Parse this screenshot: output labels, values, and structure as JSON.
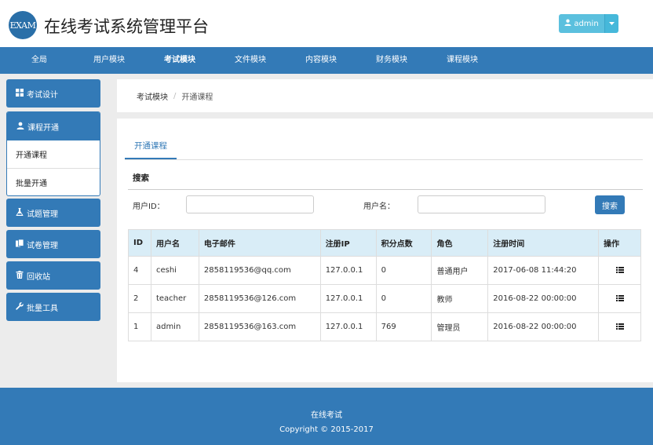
{
  "header": {
    "logo_text": "EXAM",
    "title": "在线考试系统管理平台",
    "user_name": "admin",
    "user_icon": "user-icon",
    "caret_icon": "caret-down-icon"
  },
  "nav": {
    "items": [
      {
        "label": "全局"
      },
      {
        "label": "用户模块"
      },
      {
        "label": "考试模块"
      },
      {
        "label": "文件模块"
      },
      {
        "label": "内容模块"
      },
      {
        "label": "财务模块"
      },
      {
        "label": "课程模块"
      }
    ],
    "active": "考试模块"
  },
  "sidebar": {
    "exam_design": {
      "label": "考试设计",
      "icon": "grid-icon"
    },
    "course_open": {
      "label": "课程开通",
      "icon": "user-icon",
      "subitems": [
        {
          "label": "开通课程"
        },
        {
          "label": "批量开通"
        }
      ]
    },
    "question_mgmt": {
      "label": "试题管理",
      "icon": "flask-icon"
    },
    "paper_mgmt": {
      "label": "试卷管理",
      "icon": "copy-icon"
    },
    "recycle": {
      "label": "回收站",
      "icon": "trash-icon"
    },
    "batch_tools": {
      "label": "批量工具",
      "icon": "wrench-icon"
    }
  },
  "breadcrumb": {
    "parent": "考试模块",
    "separator": "/",
    "current": "开通课程"
  },
  "main": {
    "tab": "开通课程",
    "search": {
      "title": "搜索",
      "user_id_label": "用户ID：",
      "user_id_value": "",
      "username_label": "用户名：",
      "username_value": "",
      "button": "搜索"
    },
    "table": {
      "headers": [
        "ID",
        "用户名",
        "电子邮件",
        "注册IP",
        "积分点数",
        "角色",
        "注册时间",
        "操作"
      ],
      "rows": [
        [
          "4",
          "ceshi",
          "2858119536@qq.com",
          "127.0.0.1",
          "0",
          "普通用户",
          "2017-06-08 11:44:20"
        ],
        [
          "2",
          "teacher",
          "2858119536@126.com",
          "127.0.0.1",
          "0",
          "教师",
          "2016-08-22 00:00:00"
        ],
        [
          "1",
          "admin",
          "2858119536@163.com",
          "127.0.0.1",
          "769",
          "管理员",
          "2016-08-22 00:00:00"
        ]
      ],
      "action_icon": "list-icon"
    }
  },
  "footer": {
    "line1": "在线考试",
    "line2": "Copyright © 2015-2017"
  },
  "colors": {
    "primary": "#337ab7",
    "info": "#5bc0de",
    "table_header": "#d9edf7"
  }
}
